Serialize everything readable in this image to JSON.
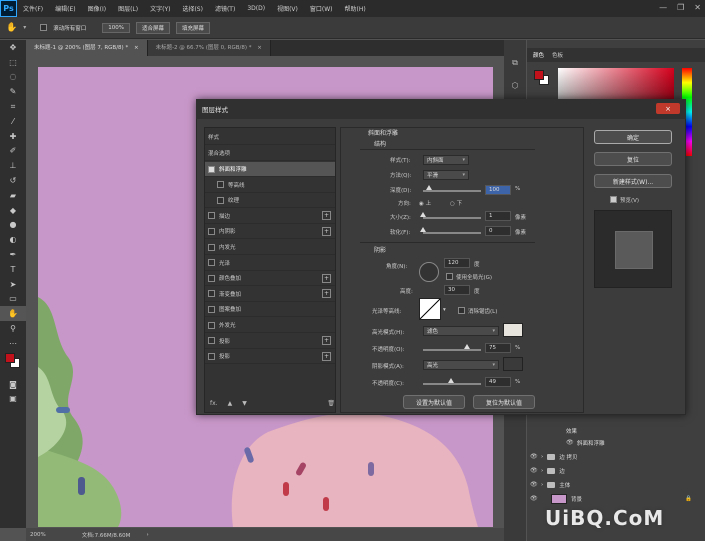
{
  "app": {
    "logo": "Ps",
    "menu": [
      "文件(F)",
      "编辑(E)",
      "图像(I)",
      "图层(L)",
      "文字(Y)",
      "选择(S)",
      "滤镜(T)",
      "3D(D)",
      "视图(V)",
      "窗口(W)",
      "帮助(H)"
    ],
    "window_controls": [
      "—",
      "❐",
      "✕"
    ]
  },
  "options_bar": {
    "scroll_all_label": "滚动所有窗口",
    "zoom_value": "100%",
    "fit_screen_label": "适合屏幕",
    "fill_screen_label": "填充屏幕"
  },
  "tabs": [
    {
      "label": "未标题-1 @ 200% (图层 7, RGB/8) *",
      "close": "×"
    },
    {
      "label": "未标题-2 @ 66.7% (图层 0, RGB/8) *",
      "close": "×"
    }
  ],
  "status": {
    "zoom": "200%",
    "doc": "文档:7.66M/8.60M"
  },
  "panels": {
    "color_tabs": [
      "颜色",
      "色板"
    ],
    "layers": [
      {
        "name": "效果",
        "kind": "effects"
      },
      {
        "name": "斜面和浮雕",
        "kind": "effect"
      },
      {
        "name": "边 拷贝",
        "kind": "folder"
      },
      {
        "name": "边",
        "kind": "folder"
      },
      {
        "name": "主体",
        "kind": "folder"
      },
      {
        "name": "背景",
        "kind": "layer"
      }
    ]
  },
  "dialog": {
    "title": "图层样式",
    "close_icon": "×",
    "style_list_header": "样式",
    "blend_options": "混合选项",
    "styles": [
      {
        "label": "斜面和浮雕",
        "checked": true,
        "selected": true,
        "plus": false
      },
      {
        "label": "等高线",
        "checked": false,
        "sub": true,
        "plus": false
      },
      {
        "label": "纹理",
        "checked": false,
        "sub": true,
        "plus": false
      },
      {
        "label": "描边",
        "checked": false,
        "plus": true
      },
      {
        "label": "内阴影",
        "checked": false,
        "plus": true
      },
      {
        "label": "内发光",
        "checked": false,
        "plus": false
      },
      {
        "label": "光泽",
        "checked": false,
        "plus": false
      },
      {
        "label": "颜色叠加",
        "checked": false,
        "plus": true
      },
      {
        "label": "渐变叠加",
        "checked": false,
        "plus": true
      },
      {
        "label": "图案叠加",
        "checked": false,
        "plus": false
      },
      {
        "label": "外发光",
        "checked": false,
        "plus": false
      },
      {
        "label": "投影",
        "checked": false,
        "plus": true
      },
      {
        "label": "投影",
        "checked": false,
        "plus": true
      }
    ],
    "footer_icons": [
      "fx.",
      "▲",
      "▼",
      "🗑"
    ],
    "bevel": {
      "title": "斜面和浮雕",
      "structure": "结构",
      "style_label": "样式(T):",
      "style_value": "内斜面",
      "technique_label": "方法(Q):",
      "technique_value": "平滑",
      "depth_label": "深度(D):",
      "depth_value": "100",
      "depth_unit": "%",
      "depth_level": 0.1,
      "direction_label": "方向:",
      "dir_up": "上",
      "dir_down": "下",
      "size_label": "大小(Z):",
      "size_value": "1",
      "size_unit": "像素",
      "soften_label": "软化(F):",
      "soften_value": "0",
      "soften_unit": "像素",
      "shading": "阴影",
      "angle_label": "角度(N):",
      "angle_value": "120",
      "angle_unit": "度",
      "global_light_label": "使用全局光(G)",
      "altitude_label": "高度:",
      "altitude_value": "30",
      "altitude_unit": "度",
      "gloss_label": "光泽等高线:",
      "antialias_label": "消除锯齿(L)",
      "highlight_label": "高光模式(H):",
      "highlight_value": "滤色",
      "highlight_color": "#e6e4dc",
      "hl_opacity_label": "不透明度(O):",
      "hl_opacity_value": "75",
      "shadow_label": "阴影模式(A):",
      "shadow_value": "高光",
      "shadow_color": "#3a3a3a",
      "sh_opacity_label": "不透明度(C):",
      "sh_opacity_value": "49",
      "percent": "%",
      "make_default": "设置为默认值",
      "reset_default": "复位为默认值"
    },
    "buttons": {
      "ok": "确定",
      "reset": "复位",
      "new_style": "新建样式(W)...",
      "preview": "预览(V)"
    }
  },
  "watermark": "UiBQ.CoM",
  "colors": {
    "canvas": "#c897c9",
    "fg_swatch": "#c1121c",
    "bg_swatch": "#ffffff"
  }
}
